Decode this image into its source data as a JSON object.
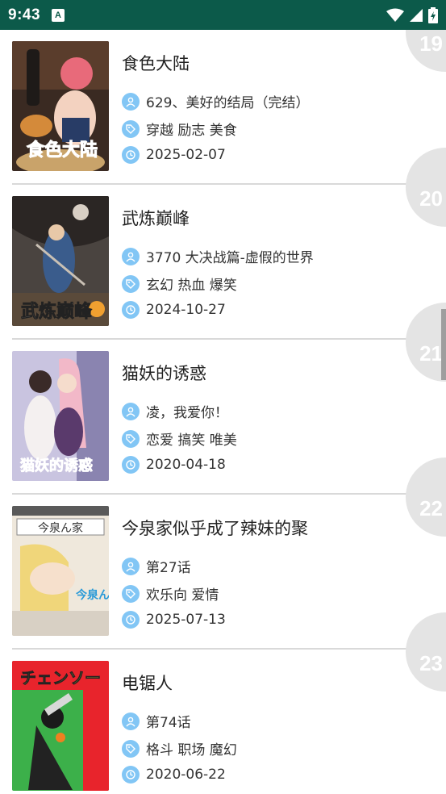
{
  "status_bar": {
    "time": "9:43",
    "indicator_letter": "A",
    "icons": [
      "wifi-icon",
      "signal-icon",
      "battery-icon"
    ]
  },
  "colors": {
    "status_bar": "#0c5a4a",
    "icon_circle": "#82c6f5",
    "rank_badge": "#e4e4e4",
    "divider": "#d9d9d9"
  },
  "comics": [
    {
      "rank": "19",
      "title": "食色大陆",
      "latest": "629、美好的结局（完结）",
      "tags": "穿越 励志 美食",
      "date": "2025-02-07",
      "cover_text": "食色大陆"
    },
    {
      "rank": "20",
      "title": "武炼巅峰",
      "latest": "3770 大决战篇-虚假的世界",
      "tags": "玄幻 热血 爆笑",
      "date": "2024-10-27",
      "cover_text": "武炼巅峰"
    },
    {
      "rank": "21",
      "title": "猫妖的诱惑",
      "latest": "凌，我爱你！",
      "tags": "恋爱 搞笑 唯美",
      "date": "2020-04-18",
      "cover_text": "猫妖的诱惑"
    },
    {
      "rank": "22",
      "title": "今泉家似乎成了辣妹的聚",
      "latest": "第27话",
      "tags": "欢乐向 爱情",
      "date": "2025-07-13",
      "cover_text": "今泉ん家"
    },
    {
      "rank": "23",
      "title": "电锯人",
      "latest": "第74话",
      "tags": "格斗 职场 魔幻",
      "date": "2020-06-22",
      "cover_text": "チェンソー"
    }
  ]
}
